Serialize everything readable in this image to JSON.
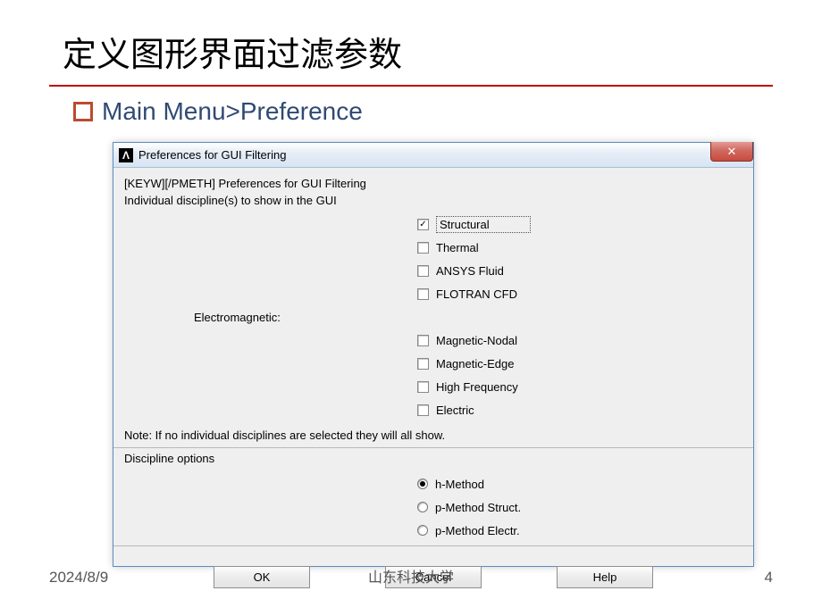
{
  "slide": {
    "title": "定义图形界面过滤参数",
    "breadcrumb": "Main Menu>Preference",
    "footer_date": "2024/8/9",
    "footer_center": "山东科技大学",
    "page_number": "4"
  },
  "dialog": {
    "title": "Preferences for GUI Filtering",
    "close_glyph": "✕",
    "line1": "[KEYW][/PMETH] Preferences for GUI Filtering",
    "line2": "Individual discipline(s) to show in the GUI",
    "em_label": "Electromagnetic:",
    "disciplines": [
      {
        "label": "Structural",
        "checked": true,
        "focused": true
      },
      {
        "label": "Thermal",
        "checked": false,
        "focused": false
      },
      {
        "label": "ANSYS Fluid",
        "checked": false,
        "focused": false
      },
      {
        "label": "FLOTRAN CFD",
        "checked": false,
        "focused": false
      }
    ],
    "em_options": [
      {
        "label": "Magnetic-Nodal",
        "checked": false
      },
      {
        "label": "Magnetic-Edge",
        "checked": false
      },
      {
        "label": "High Frequency",
        "checked": false
      },
      {
        "label": "Electric",
        "checked": false
      }
    ],
    "note": "Note: If no individual disciplines are selected they will all show.",
    "section2_label": "Discipline options",
    "methods": [
      {
        "label": "h-Method",
        "checked": true
      },
      {
        "label": "p-Method Struct.",
        "checked": false
      },
      {
        "label": "p-Method Electr.",
        "checked": false
      }
    ],
    "buttons": {
      "ok": "OK",
      "cancel": "Cancel",
      "help": "Help"
    }
  }
}
